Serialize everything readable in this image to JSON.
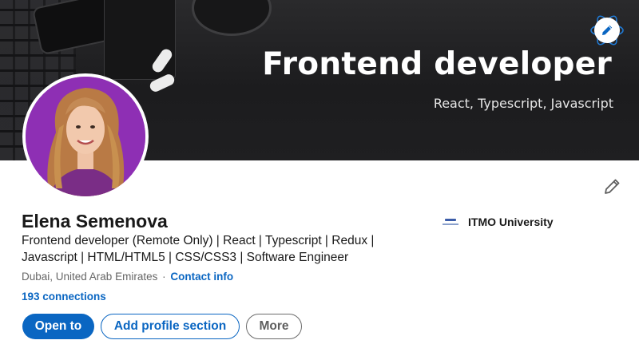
{
  "banner": {
    "title": "Frontend developer",
    "subtitle": "React, Typescript, Javascript"
  },
  "profile": {
    "name": "Elena Semenova",
    "headline": "Frontend developer (Remote Only) | React | Typescript | Redux | Javascript | HTML/HTML5 | CSS/CSS3 | Software Engineer",
    "location": "Dubai, United Arab Emirates",
    "separator": "·",
    "contact_link": "Contact info",
    "connections": "193 connections"
  },
  "education": {
    "school": "ITMO University"
  },
  "actions": {
    "open_to": "Open to",
    "add_section": "Add profile section",
    "more": "More"
  },
  "icons": {
    "banner_edit": "pencil-icon",
    "profile_edit": "pencil-icon",
    "school_logo": "itmo-logo-icon",
    "react_logo": "react-atom-icon"
  },
  "colors": {
    "accent": "#0a66c2",
    "avatar_background": "#8e2fb4"
  }
}
